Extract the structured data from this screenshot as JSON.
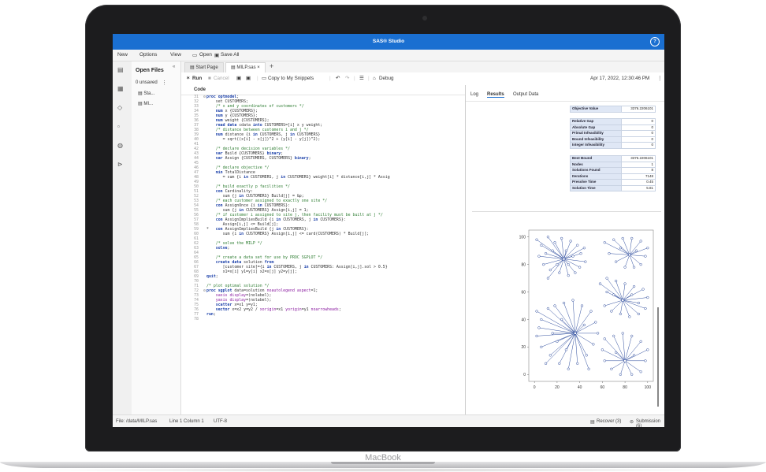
{
  "app": {
    "title": "SAS® Studio",
    "help_glyph": "?"
  },
  "menu": {
    "new": "New",
    "options": "Options",
    "view": "View",
    "open": "Open",
    "save_all": "Save All"
  },
  "nav": {
    "title": "Open Files",
    "collapse_glyph": "«",
    "unsaved": "0 unsaved",
    "files": [
      "Sta...",
      "MI..."
    ]
  },
  "tabs": [
    {
      "label": "Start Page"
    },
    {
      "label": "MILP.sas"
    }
  ],
  "toolbar": {
    "run": "Run",
    "cancel": "Cancel",
    "copy_snippets": "Copy to My Snippets",
    "debug": "Debug",
    "datetime": "Apr 17, 2022, 12:30:46 PM"
  },
  "editor": {
    "header": "Code",
    "lines": [
      {
        "n": "31",
        "fold": true,
        "p": [
          [
            "proc optmodel",
            "kw"
          ],
          [
            ";",
            ""
          ]
        ]
      },
      {
        "n": "32",
        "p": [
          [
            "    set CUSTOMERS;",
            ""
          ]
        ]
      },
      {
        "n": "33",
        "p": [
          [
            "    /* x and y coordinates of customers */",
            "cm"
          ]
        ]
      },
      {
        "n": "34",
        "p": [
          [
            "    ",
            ""
          ],
          [
            "num",
            "kw"
          ],
          [
            " x {CUSTOMERS};",
            ""
          ]
        ]
      },
      {
        "n": "35",
        "p": [
          [
            "    ",
            ""
          ],
          [
            "num",
            "kw"
          ],
          [
            " y {CUSTOMERS};",
            ""
          ]
        ]
      },
      {
        "n": "36",
        "p": [
          [
            "    ",
            ""
          ],
          [
            "num",
            "kw"
          ],
          [
            " weight {CUSTOMERS};",
            ""
          ]
        ]
      },
      {
        "n": "37",
        "p": [
          [
            "    ",
            ""
          ],
          [
            "read data",
            "kw"
          ],
          [
            " cdata ",
            ""
          ],
          [
            "into",
            "kw"
          ],
          [
            " CUSTOMERS=[i] x y weight;",
            ""
          ]
        ]
      },
      {
        "n": "38",
        "p": [
          [
            "    /* distance between customers i and j */",
            "cm"
          ]
        ]
      },
      {
        "n": "39",
        "p": [
          [
            "    ",
            ""
          ],
          [
            "num",
            "kw"
          ],
          [
            " distance {i ",
            ""
          ],
          [
            "in",
            "kw"
          ],
          [
            " CUSTOMERS, j ",
            ""
          ],
          [
            "in",
            "kw"
          ],
          [
            " CUSTOMERS}",
            ""
          ]
        ]
      },
      {
        "n": "40",
        "p": [
          [
            "       = sqrt((x[i] - x[j])^2 + (y[i] - y[j])^2);",
            ""
          ]
        ]
      },
      {
        "n": "41",
        "p": [
          [
            "",
            ""
          ]
        ]
      },
      {
        "n": "42",
        "p": [
          [
            "    /* declare decision variables */",
            "cm"
          ]
        ]
      },
      {
        "n": "43",
        "p": [
          [
            "    ",
            ""
          ],
          [
            "var",
            "kw"
          ],
          [
            " Build {CUSTOMERS} ",
            ""
          ],
          [
            "binary",
            "kw"
          ],
          [
            ";",
            ""
          ]
        ]
      },
      {
        "n": "44",
        "p": [
          [
            "    ",
            ""
          ],
          [
            "var",
            "kw"
          ],
          [
            " Assign {CUSTOMERS, CUSTOMERS} ",
            ""
          ],
          [
            "binary",
            "kw"
          ],
          [
            ";",
            ""
          ]
        ]
      },
      {
        "n": "45",
        "p": [
          [
            "",
            ""
          ]
        ]
      },
      {
        "n": "46",
        "p": [
          [
            "    /* declare objective */",
            "cm"
          ]
        ]
      },
      {
        "n": "47",
        "p": [
          [
            "    ",
            ""
          ],
          [
            "min",
            "kw"
          ],
          [
            " TotalDistance",
            ""
          ]
        ]
      },
      {
        "n": "48",
        "p": [
          [
            "       = sum {i ",
            ""
          ],
          [
            "in",
            "kw"
          ],
          [
            " CUSTOMERS, j ",
            ""
          ],
          [
            "in",
            "kw"
          ],
          [
            " CUSTOMERS} weight[i] * distance[i,j] * Assig",
            ""
          ]
        ]
      },
      {
        "n": "49",
        "p": [
          [
            "",
            ""
          ]
        ]
      },
      {
        "n": "50",
        "p": [
          [
            "    /* build exactly p facilities */",
            "cm"
          ]
        ]
      },
      {
        "n": "51",
        "p": [
          [
            "    ",
            ""
          ],
          [
            "con",
            "kw"
          ],
          [
            " Cardinality:",
            ""
          ]
        ]
      },
      {
        "n": "52",
        "p": [
          [
            "       sum {j ",
            ""
          ],
          [
            "in",
            "kw"
          ],
          [
            " CUSTOMERS} Build[j] = &p;",
            ""
          ]
        ]
      },
      {
        "n": "53",
        "p": [
          [
            "    /* each customer assigned to exactly one site */",
            "cm"
          ]
        ]
      },
      {
        "n": "54",
        "p": [
          [
            "    ",
            ""
          ],
          [
            "con",
            "kw"
          ],
          [
            " AssignOnce {i ",
            ""
          ],
          [
            "in",
            "kw"
          ],
          [
            " CUSTOMERS}:",
            ""
          ]
        ]
      },
      {
        "n": "55",
        "p": [
          [
            "       sum {j ",
            ""
          ],
          [
            "in",
            "kw"
          ],
          [
            " CUSTOMERS} Assign[i,j] = 1;",
            ""
          ]
        ]
      },
      {
        "n": "56",
        "p": [
          [
            "    /* if customer i assigned to site j, then facility must be built at j */",
            "cm"
          ]
        ]
      },
      {
        "n": "57",
        "p": [
          [
            "    ",
            ""
          ],
          [
            "con",
            "kw"
          ],
          [
            " AssignImpliesBuild {i ",
            ""
          ],
          [
            "in",
            "kw"
          ],
          [
            " CUSTOMERS, j ",
            ""
          ],
          [
            "in",
            "kw"
          ],
          [
            " CUSTOMERS}:",
            ""
          ]
        ]
      },
      {
        "n": "58",
        "p": [
          [
            "       Assign[i,j] <= Build[j];",
            ""
          ]
        ]
      },
      {
        "n": "59",
        "p": [
          [
            "*   ",
            ""
          ],
          [
            "con",
            "kw"
          ],
          [
            " AssignImpliesBuild {j ",
            ""
          ],
          [
            "in",
            "kw"
          ],
          [
            " CUSTOMERS}:",
            ""
          ]
        ]
      },
      {
        "n": "60",
        "p": [
          [
            "       sum {i ",
            ""
          ],
          [
            "in",
            "kw"
          ],
          [
            " CUSTOMERS} Assign[i,j] <= card(CUSTOMERS) * Build[j];",
            ""
          ]
        ]
      },
      {
        "n": "61",
        "p": [
          [
            "",
            ""
          ]
        ]
      },
      {
        "n": "62",
        "p": [
          [
            "    /* solve the MILP */",
            "cm"
          ]
        ]
      },
      {
        "n": "63",
        "p": [
          [
            "    ",
            ""
          ],
          [
            "solve",
            "kw"
          ],
          [
            ";",
            ""
          ]
        ]
      },
      {
        "n": "64",
        "p": [
          [
            "",
            ""
          ]
        ]
      },
      {
        "n": "65",
        "p": [
          [
            "    /* create a data set for use by PROC SGPLOT */",
            "cm"
          ]
        ]
      },
      {
        "n": "66",
        "p": [
          [
            "    ",
            ""
          ],
          [
            "create data",
            "kw"
          ],
          [
            " solution ",
            ""
          ],
          [
            "from",
            "kw"
          ]
        ]
      },
      {
        "n": "67",
        "p": [
          [
            "       [customer site]={i ",
            ""
          ],
          [
            "in",
            "kw"
          ],
          [
            " CUSTOMERS, j ",
            ""
          ],
          [
            "in",
            "kw"
          ],
          [
            " CUSTOMERS: Assign[i,j].sol > 0.5}",
            ""
          ]
        ]
      },
      {
        "n": "68",
        "p": [
          [
            "       x1=x[i] y1=y[i] x2=x[j] y2=y[j];",
            ""
          ]
        ]
      },
      {
        "n": "69",
        "p": [
          [
            "quit",
            "kw"
          ],
          [
            ";",
            ""
          ]
        ]
      },
      {
        "n": "70",
        "p": [
          [
            "",
            ""
          ]
        ]
      },
      {
        "n": "71",
        "p": [
          [
            "/* plot optimal solution */",
            "cm"
          ]
        ]
      },
      {
        "n": "72",
        "fold": true,
        "p": [
          [
            "proc sgplot",
            "kw"
          ],
          [
            " data=solution ",
            ""
          ],
          [
            "noautolegend aspect",
            "st"
          ],
          [
            "=1;",
            ""
          ]
        ]
      },
      {
        "n": "73",
        "p": [
          [
            "    ",
            ""
          ],
          [
            "xaxis display",
            "st"
          ],
          [
            "=(nolabel);",
            ""
          ]
        ]
      },
      {
        "n": "74",
        "p": [
          [
            "    ",
            ""
          ],
          [
            "yaxis display",
            "st"
          ],
          [
            "=(nolabel);",
            ""
          ]
        ]
      },
      {
        "n": "75",
        "p": [
          [
            "    ",
            ""
          ],
          [
            "scatter",
            "kw"
          ],
          [
            " x=x1 y=y1;",
            ""
          ]
        ]
      },
      {
        "n": "76",
        "p": [
          [
            "    ",
            ""
          ],
          [
            "vector",
            "kw"
          ],
          [
            " x=x2 y=y2 / ",
            ""
          ],
          [
            "xorigin",
            "st"
          ],
          [
            "=x1 ",
            ""
          ],
          [
            "yorigin",
            "st"
          ],
          [
            "=y1 ",
            ""
          ],
          [
            "noarrowheads",
            "st"
          ],
          [
            ";",
            ""
          ]
        ]
      },
      {
        "n": "77",
        "p": [
          [
            "run",
            "kw"
          ],
          [
            ";",
            ""
          ]
        ]
      },
      {
        "n": "78",
        "p": [
          [
            "",
            ""
          ]
        ]
      }
    ]
  },
  "results": {
    "tabs": [
      "Log",
      "Results",
      "Output Data"
    ],
    "group1": [
      [
        "Objective Value",
        "3376.2206101"
      ]
    ],
    "group2": [
      [
        "Relative Gap",
        "0"
      ],
      [
        "Absolute Gap",
        "0"
      ],
      [
        "Primal Infeasibility",
        "0"
      ],
      [
        "Bound Infeasibility",
        "0"
      ],
      [
        "Integer Infeasibility",
        "0"
      ]
    ],
    "group3": [
      [
        "Best Bound",
        "3376.2206101"
      ],
      [
        "Nodes",
        "1"
      ],
      [
        "Solutions Found",
        "8"
      ],
      [
        "Iterations",
        "7148"
      ],
      [
        "Presolve Time",
        "0.45"
      ],
      [
        "Solution Time",
        "5.81"
      ]
    ]
  },
  "chart_data": {
    "type": "scatter",
    "title": "",
    "xlabel": "",
    "ylabel": "",
    "xlim": [
      -5,
      105
    ],
    "ylim": [
      -5,
      105
    ],
    "xticks": [
      0,
      20,
      40,
      60,
      80,
      100
    ],
    "yticks": [
      0,
      20,
      40,
      60,
      80,
      100
    ],
    "series_color": "#2f4d9e",
    "clusters": [
      {
        "site": [
          26,
          84
        ],
        "customers": [
          [
            2,
            98
          ],
          [
            6,
            94
          ],
          [
            12,
            100
          ],
          [
            18,
            96
          ],
          [
            24,
            99
          ],
          [
            32,
            97
          ],
          [
            38,
            94
          ],
          [
            44,
            92
          ],
          [
            41,
            88
          ],
          [
            45,
            82
          ],
          [
            40,
            78
          ],
          [
            36,
            74
          ],
          [
            30,
            72
          ],
          [
            22,
            74
          ],
          [
            14,
            76
          ],
          [
            8,
            80
          ],
          [
            4,
            86
          ],
          [
            10,
            88
          ],
          [
            16,
            90
          ],
          [
            28,
            90
          ],
          [
            34,
            86
          ],
          [
            20,
            80
          ],
          [
            12,
            70
          ],
          [
            30,
            80
          ]
        ]
      },
      {
        "site": [
          84,
          87
        ],
        "customers": [
          [
            62,
            96
          ],
          [
            70,
            98
          ],
          [
            78,
            99
          ],
          [
            86,
            99
          ],
          [
            94,
            97
          ],
          [
            100,
            92
          ],
          [
            98,
            86
          ],
          [
            94,
            80
          ],
          [
            88,
            78
          ],
          [
            80,
            78
          ],
          [
            72,
            82
          ],
          [
            66,
            88
          ],
          [
            76,
            92
          ],
          [
            90,
            90
          ]
        ]
      },
      {
        "site": [
          78,
          54
        ],
        "customers": [
          [
            58,
            66
          ],
          [
            64,
            70
          ],
          [
            72,
            68
          ],
          [
            80,
            66
          ],
          [
            88,
            64
          ],
          [
            96,
            62
          ],
          [
            100,
            56
          ],
          [
            98,
            48
          ],
          [
            92,
            44
          ],
          [
            84,
            42
          ],
          [
            76,
            44
          ],
          [
            68,
            46
          ],
          [
            62,
            50
          ],
          [
            70,
            58
          ],
          [
            86,
            58
          ],
          [
            92,
            52
          ],
          [
            64,
            60
          ]
        ]
      },
      {
        "site": [
          36,
          30
        ],
        "customers": [
          [
            2,
            46
          ],
          [
            6,
            40
          ],
          [
            12,
            48
          ],
          [
            18,
            50
          ],
          [
            26,
            52
          ],
          [
            34,
            54
          ],
          [
            42,
            50
          ],
          [
            50,
            46
          ],
          [
            54,
            38
          ],
          [
            56,
            30
          ],
          [
            52,
            22
          ],
          [
            46,
            14
          ],
          [
            38,
            8
          ],
          [
            30,
            4
          ],
          [
            22,
            8
          ],
          [
            14,
            14
          ],
          [
            6,
            20
          ],
          [
            2,
            28
          ],
          [
            4,
            34
          ],
          [
            16,
            30
          ],
          [
            24,
            40
          ],
          [
            44,
            36
          ],
          [
            28,
            18
          ],
          [
            10,
            8
          ],
          [
            48,
            4
          ],
          [
            20,
            24
          ]
        ]
      },
      {
        "site": [
          80,
          10
        ],
        "customers": [
          [
            62,
            26
          ],
          [
            70,
            28
          ],
          [
            78,
            30
          ],
          [
            86,
            28
          ],
          [
            94,
            24
          ],
          [
            100,
            18
          ],
          [
            98,
            10
          ],
          [
            94,
            2
          ],
          [
            86,
            0
          ],
          [
            76,
            0
          ],
          [
            68,
            4
          ],
          [
            62,
            10
          ],
          [
            60,
            18
          ],
          [
            72,
            16
          ],
          [
            88,
            14
          ]
        ]
      }
    ]
  },
  "status": {
    "file": "File: /data/MILP.sas",
    "pos": "Line 1 Column 1",
    "encoding": "UTF-8",
    "recover": "Recover (3)",
    "submission": "Submission (6)"
  },
  "device": {
    "brand": "MacBook"
  }
}
